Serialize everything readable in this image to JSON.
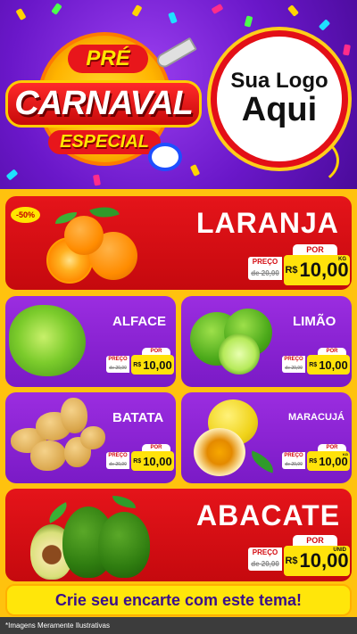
{
  "header": {
    "title_pre": "PRÉ",
    "title_main": "CARNAVAL",
    "title_sub": "ESPECIAL",
    "logo_placeholder_line1": "Sua Logo",
    "logo_placeholder_line2": "Aqui"
  },
  "products": [
    {
      "name": "LARANJA",
      "discount_badge": "-50%",
      "preco_label": "PREÇO",
      "por_label": "POR",
      "old_price": "de 20,00",
      "currency": "R$",
      "price": "10,00",
      "unit": "KG"
    },
    {
      "name": "ALFACE",
      "preco_label": "PREÇO",
      "por_label": "POR",
      "old_price": "de 20,00",
      "currency": "R$",
      "price": "10,00",
      "unit": ""
    },
    {
      "name": "LIMÃO",
      "preco_label": "PREÇO",
      "por_label": "POR",
      "old_price": "de 20,00",
      "currency": "R$",
      "price": "10,00",
      "unit": ""
    },
    {
      "name": "BATATA",
      "preco_label": "PREÇO",
      "por_label": "POR",
      "old_price": "de 20,00",
      "currency": "R$",
      "price": "10,00",
      "unit": ""
    },
    {
      "name": "MARACUJÁ",
      "preco_label": "PREÇO",
      "por_label": "POR",
      "old_price": "de 20,00",
      "currency": "R$",
      "price": "10,00",
      "unit": "KG"
    },
    {
      "name": "ABACATE",
      "preco_label": "PREÇO",
      "por_label": "POR",
      "old_price": "de 20,00",
      "currency": "R$",
      "price": "10,00",
      "unit": "UNID"
    }
  ],
  "footer": {
    "cta": "Crie seu encarte com este tema!",
    "disclaimer": "*Imagens Meramente Ilustrativas"
  },
  "colors": {
    "red_card": "#e5141a",
    "purple_card": "#9b2de0",
    "background": "#ffc20e",
    "price_yellow": "#ffe20a"
  }
}
